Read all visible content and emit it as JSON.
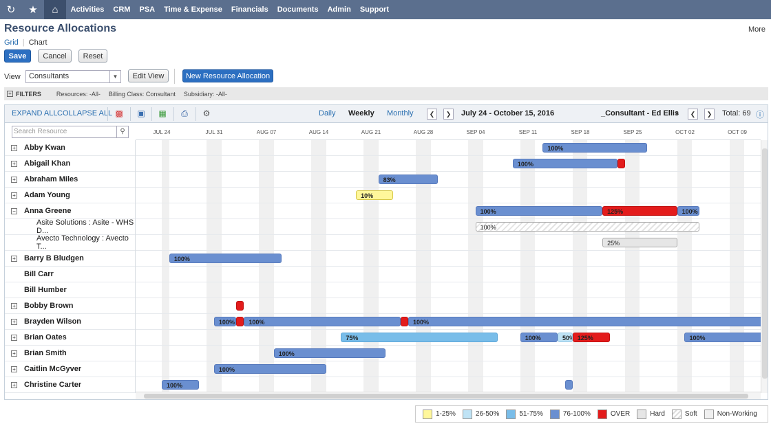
{
  "nav": {
    "items": [
      "Activities",
      "CRM",
      "PSA",
      "Time & Expense",
      "Financials",
      "Documents",
      "Admin",
      "Support"
    ]
  },
  "page": {
    "title": "Resource Allocations",
    "more": "More",
    "view_grid": "Grid",
    "view_chart": "Chart"
  },
  "buttons": {
    "save": "Save",
    "cancel": "Cancel",
    "reset": "Reset",
    "edit_view": "Edit View",
    "new_allocation": "New Resource Allocation"
  },
  "view": {
    "label": "View",
    "selected": "Consultants"
  },
  "filters": {
    "label": "FILTERS",
    "resources": "Resources: -All-",
    "billing_class": "Billing Class: Consultant",
    "subsidiary": "Subsidiary: -All-"
  },
  "toolbar": {
    "expand_all": "EXPAND ALL",
    "collapse_all": "COLLAPSE ALL",
    "daily": "Daily",
    "weekly": "Weekly",
    "monthly": "Monthly",
    "date_range": "July 24 - October 15, 2016",
    "resource": "_Consultant - Ed Ellis",
    "total": "Total: 69"
  },
  "search": {
    "placeholder": "Search Resource"
  },
  "dates": [
    "JUL 24",
    "JUL 31",
    "AUG 07",
    "AUG 14",
    "AUG 21",
    "AUG 28",
    "SEP 04",
    "SEP 11",
    "SEP 18",
    "SEP 25",
    "OCT 02",
    "OCT 09"
  ],
  "rows": [
    {
      "name": "Abby Kwan",
      "type": "parent"
    },
    {
      "name": "Abigail Khan",
      "type": "parent"
    },
    {
      "name": "Abraham Miles",
      "type": "parent"
    },
    {
      "name": "Adam Young",
      "type": "parent"
    },
    {
      "name": "Anna Greene",
      "type": "expanded"
    },
    {
      "name": "Asite Solutions : Asite - WHS D...",
      "type": "sub"
    },
    {
      "name": "Avecto Technology : Avecto T...",
      "type": "sub"
    },
    {
      "name": "Barry B Bludgen",
      "type": "parent"
    },
    {
      "name": "Bill Carr",
      "type": "nopm"
    },
    {
      "name": "Bill Humber",
      "type": "nopm"
    },
    {
      "name": "Bobby Brown",
      "type": "parent"
    },
    {
      "name": "Brayden Wilson",
      "type": "parent"
    },
    {
      "name": "Brian Oates",
      "type": "parent"
    },
    {
      "name": "Brian Smith",
      "type": "parent"
    },
    {
      "name": "Caitlin McGyver",
      "type": "parent"
    },
    {
      "name": "Christine Carter",
      "type": "parent"
    }
  ],
  "bars": [
    {
      "row": 0,
      "start": "2016-09-13",
      "end": "2016-09-27",
      "label": "100%",
      "cls": "c76"
    },
    {
      "row": 1,
      "start": "2016-09-09",
      "end": "2016-09-23",
      "label": "100%",
      "cls": "c76"
    },
    {
      "row": 1,
      "start": "2016-09-23",
      "end": "2016-09-24",
      "label": "",
      "cls": "cover"
    },
    {
      "row": 2,
      "start": "2016-08-22",
      "end": "2016-08-30",
      "label": "83%",
      "cls": "c76"
    },
    {
      "row": 3,
      "start": "2016-08-19",
      "end": "2016-08-24",
      "label": "10%",
      "cls": "c1"
    },
    {
      "row": 4,
      "start": "2016-09-04",
      "end": "2016-09-21",
      "label": "100%",
      "cls": "c76"
    },
    {
      "row": 4,
      "start": "2016-09-21",
      "end": "2016-10-01",
      "label": "125%",
      "cls": "cover"
    },
    {
      "row": 4,
      "start": "2016-10-01",
      "end": "2016-10-04",
      "label": "100%",
      "cls": "c76"
    },
    {
      "row": 5,
      "start": "2016-09-04",
      "end": "2016-10-04",
      "label": "100%",
      "cls": "csoft"
    },
    {
      "row": 6,
      "start": "2016-09-21",
      "end": "2016-10-01",
      "label": "25%",
      "cls": "chard"
    },
    {
      "row": 7,
      "start": "2016-07-25",
      "end": "2016-08-09",
      "label": "100%",
      "cls": "c76"
    },
    {
      "row": 10,
      "start": "2016-08-03",
      "end": "2016-08-04",
      "label": "",
      "cls": "cover"
    },
    {
      "row": 11,
      "start": "2016-07-31",
      "end": "2016-08-03",
      "label": "100%",
      "cls": "c76"
    },
    {
      "row": 11,
      "start": "2016-08-03",
      "end": "2016-08-04",
      "label": "",
      "cls": "cover"
    },
    {
      "row": 11,
      "start": "2016-08-04",
      "end": "2016-08-25",
      "label": "100%",
      "cls": "c76"
    },
    {
      "row": 11,
      "start": "2016-08-25",
      "end": "2016-08-26",
      "label": "",
      "cls": "cover"
    },
    {
      "row": 11,
      "start": "2016-08-26",
      "end": "2016-10-20",
      "label": "100%",
      "cls": "c76"
    },
    {
      "row": 12,
      "start": "2016-08-17",
      "end": "2016-09-07",
      "label": "75%",
      "cls": "c51"
    },
    {
      "row": 12,
      "start": "2016-09-10",
      "end": "2016-09-15",
      "label": "100%",
      "cls": "c76"
    },
    {
      "row": 12,
      "start": "2016-09-15",
      "end": "2016-09-17",
      "label": "50%",
      "cls": "c26"
    },
    {
      "row": 12,
      "start": "2016-09-17",
      "end": "2016-09-22",
      "label": "125%",
      "cls": "cover"
    },
    {
      "row": 12,
      "start": "2016-10-02",
      "end": "2016-10-20",
      "label": "100%",
      "cls": "c76"
    },
    {
      "row": 13,
      "start": "2016-08-08",
      "end": "2016-08-23",
      "label": "100%",
      "cls": "c76"
    },
    {
      "row": 14,
      "start": "2016-07-31",
      "end": "2016-08-15",
      "label": "100%",
      "cls": "c76"
    },
    {
      "row": 15,
      "start": "2016-07-24",
      "end": "2016-07-29",
      "label": "100%",
      "cls": "c76"
    },
    {
      "row": 15,
      "start": "2016-09-16",
      "end": "2016-09-17",
      "label": "",
      "cls": "c76"
    }
  ],
  "legend": [
    {
      "label": "1-25%",
      "color": "#fff79b"
    },
    {
      "label": "26-50%",
      "color": "#bfe3f5"
    },
    {
      "label": "51-75%",
      "color": "#79bde9"
    },
    {
      "label": "76-100%",
      "color": "#6a8fd0"
    },
    {
      "label": "OVER",
      "color": "#e31c1c"
    },
    {
      "label": "Hard",
      "color": "#e6e6e6"
    },
    {
      "label": "Soft",
      "color": "#ffffff"
    },
    {
      "label": "Non-Working",
      "color": "#f0f0f0"
    }
  ]
}
